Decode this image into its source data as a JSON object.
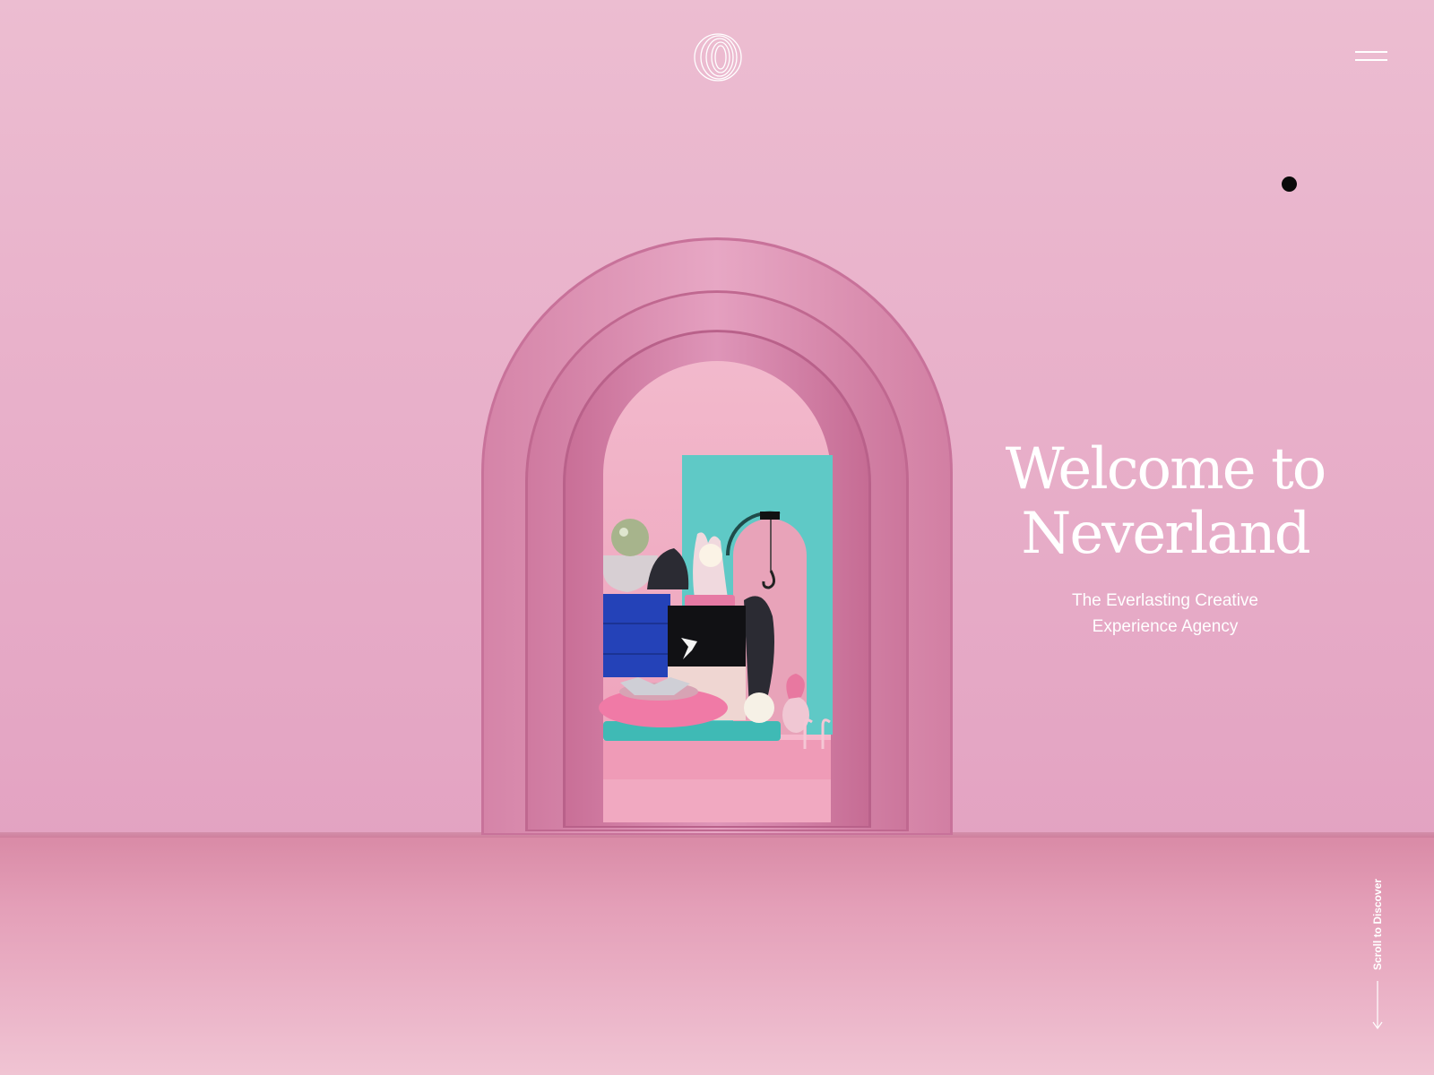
{
  "header": {
    "logo_icon": "spiral-logo-icon",
    "menu_icon": "hamburger-menu-icon"
  },
  "hero": {
    "title_line1": "Welcome to",
    "title_line2": "Neverland",
    "subtitle_line1": "The Everlasting Creative",
    "subtitle_line2": "Experience Agency"
  },
  "scroll": {
    "label": "Scroll to Discover",
    "icon": "arrow-down-icon"
  },
  "colors": {
    "wall": "#e9b2cb",
    "floor": "#e49fb8",
    "arch": "#dc8fb2",
    "teal": "#5fc9c6",
    "blue": "#2442b8",
    "text": "#ffffff"
  }
}
